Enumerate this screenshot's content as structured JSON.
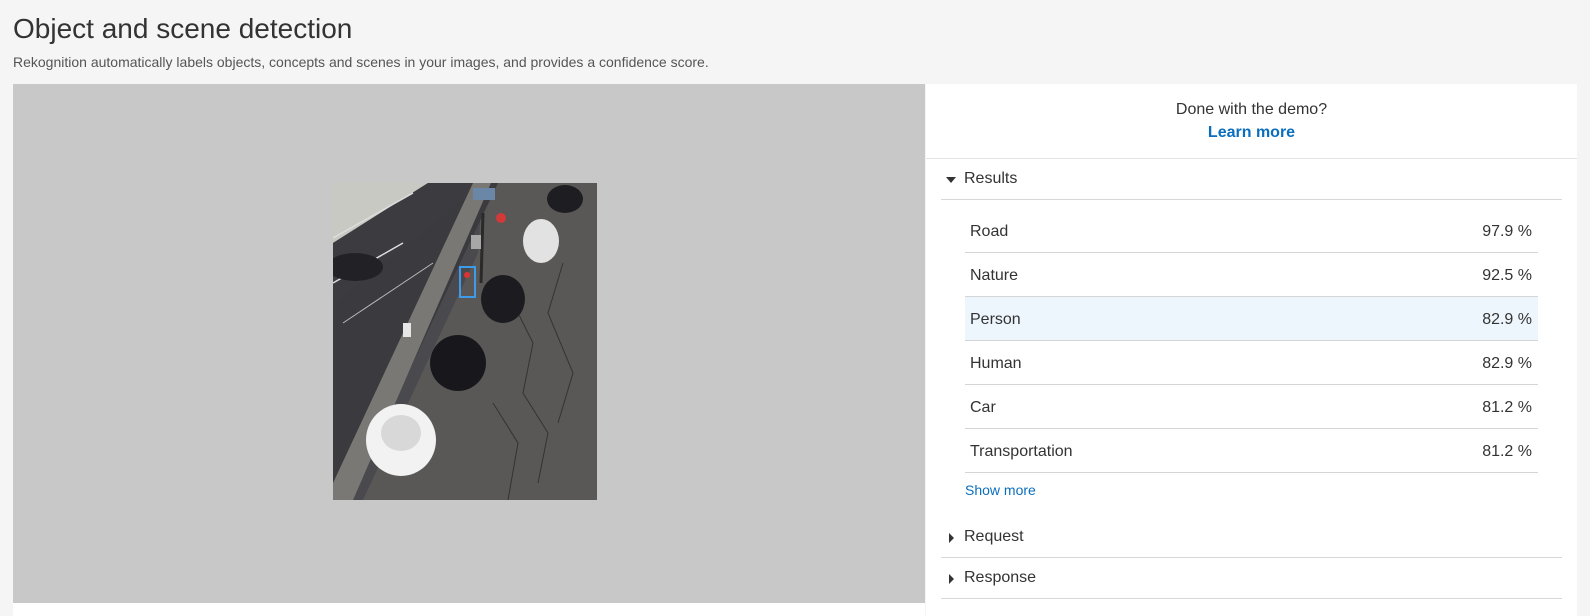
{
  "page": {
    "title": "Object and scene detection",
    "subtitle": "Rekognition automatically labels objects, concepts and scenes in your images, and provides a confidence score."
  },
  "demo": {
    "done_text": "Done with the demo?",
    "learn_more": "Learn more"
  },
  "sections": {
    "results": {
      "label": "Results",
      "expanded": true
    },
    "request": {
      "label": "Request",
      "expanded": false
    },
    "response": {
      "label": "Response",
      "expanded": false
    }
  },
  "results": [
    {
      "label": "Road",
      "confidence": "97.9 %"
    },
    {
      "label": "Nature",
      "confidence": "92.5 %"
    },
    {
      "label": "Person",
      "confidence": "82.9 %",
      "highlighted": true
    },
    {
      "label": "Human",
      "confidence": "82.9 %"
    },
    {
      "label": "Car",
      "confidence": "81.2 %"
    },
    {
      "label": "Transportation",
      "confidence": "81.2 %"
    }
  ],
  "show_more": "Show more",
  "colors": {
    "link": "#0a6ebd",
    "highlight_row": "#eef6fd",
    "bounding_box": "#3d9be9",
    "image_backdrop": "#c8c8c8"
  },
  "icons": {
    "expanded_caret": "caret-down-icon",
    "collapsed_caret": "caret-right-icon"
  }
}
